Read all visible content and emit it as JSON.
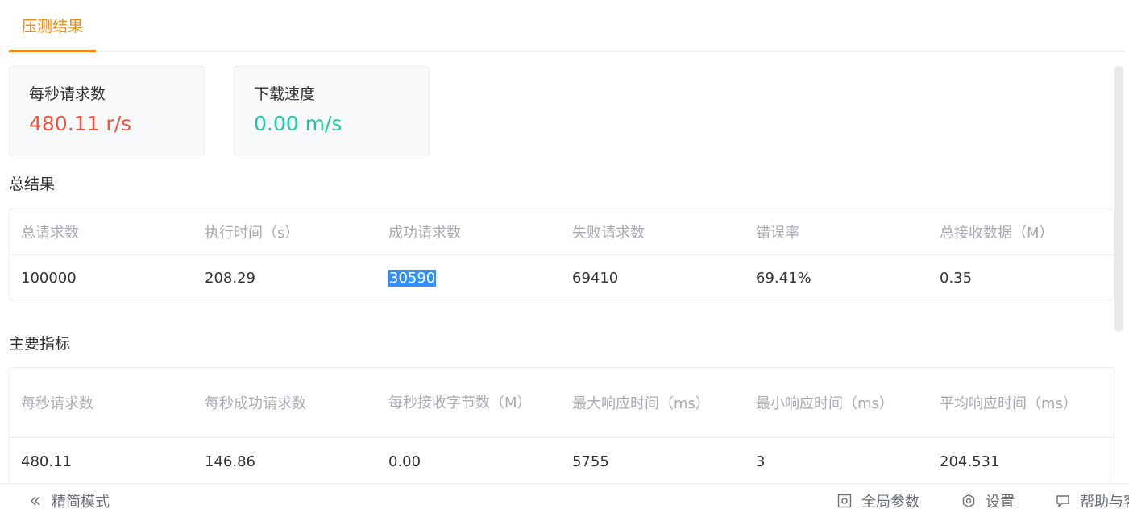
{
  "tab": {
    "label": "压测结果"
  },
  "cards": [
    {
      "label": "每秒请求数",
      "value": "480.11 r/s",
      "color": "#f2533a"
    },
    {
      "label": "下载速度",
      "value": "0.00 m/s",
      "color": "#1fc8a0"
    }
  ],
  "summary": {
    "title": "总结果",
    "headers": [
      "总请求数",
      "执行时间（s）",
      "成功请求数",
      "失败请求数",
      "错误率",
      "总接收数据（M）"
    ],
    "values": [
      "100000",
      "208.29",
      "30590",
      "69410",
      "69.41%",
      "0.35"
    ]
  },
  "metrics": {
    "title": "主要指标",
    "headers": [
      "每秒请求数",
      "每秒成功请求数",
      "每秒接收字节数（M）",
      "最大响应时间（ms）",
      "最小响应时间（ms）",
      "平均响应时间（ms）"
    ],
    "values": [
      "480.11",
      "146.86",
      "0.00",
      "5755",
      "3",
      "204.531"
    ]
  },
  "footer": {
    "simple_mode": "精简模式",
    "global_params": "全局参数",
    "settings": "设置",
    "help": "帮助与客服"
  },
  "icons": {
    "simple_mode": "double-chevron-left-icon",
    "global_params": "gear-box-icon",
    "settings": "hexagon-gear-icon",
    "help": "chat-bubble-icon"
  }
}
